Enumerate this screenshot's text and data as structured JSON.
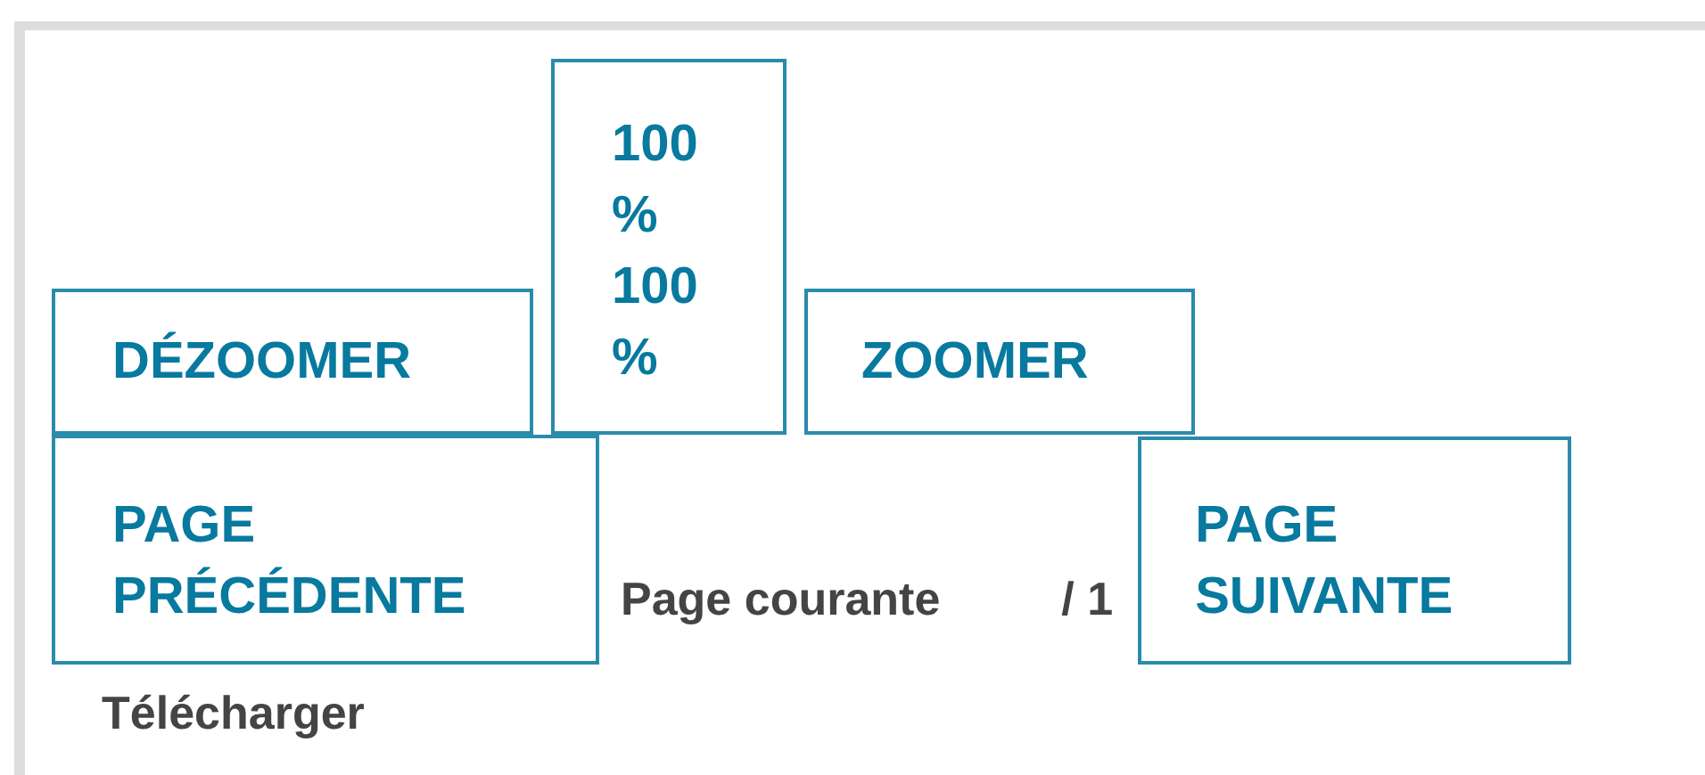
{
  "zoom_out_button": "DÉZOOMER",
  "zoom_level": [
    "100 %",
    "100 %"
  ],
  "zoom_in_button": "ZOOMER",
  "previous_page_button": "PAGE PRÉCÉDENTE",
  "current_page_label": "Page courante",
  "page_total": "/ 1",
  "next_page_button": "PAGE SUIVANTE",
  "download_link": "Télécharger"
}
